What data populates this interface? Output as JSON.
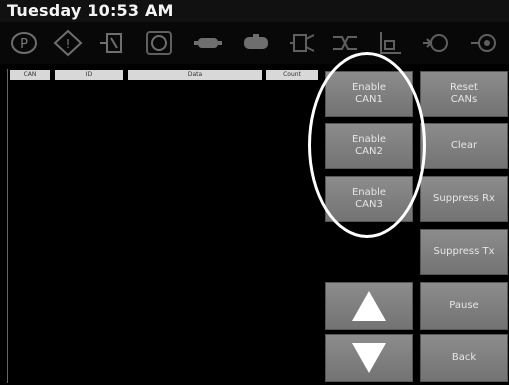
{
  "header": {
    "datetime": "Tuesday 10:53 AM"
  },
  "toolbar": {
    "icons": [
      {
        "name": "parking-icon",
        "label": "P"
      },
      {
        "name": "warning-diamond-icon",
        "label": "!"
      },
      {
        "name": "power-pack-icon"
      },
      {
        "name": "engine-icon"
      },
      {
        "name": "coupling-icon"
      },
      {
        "name": "connector-icon"
      },
      {
        "name": "valve-icon"
      },
      {
        "name": "network-icon"
      },
      {
        "name": "filter-icon"
      },
      {
        "name": "hydraulic-motor-icon"
      },
      {
        "name": "gear-motor-icon"
      }
    ]
  },
  "log": {
    "columns": [
      "CAN",
      "ID",
      "Data",
      "Count"
    ]
  },
  "buttons": {
    "enable_can1": "Enable\nCAN1",
    "enable_can2": "Enable\nCAN2",
    "enable_can3": "Enable\nCAN3",
    "reset_cans": "Reset\nCANs",
    "clear": "Clear",
    "suppress_rx": "Suppress Rx",
    "suppress_tx": "Suppress Tx",
    "pause": "Pause",
    "back": "Back"
  },
  "colors": {
    "button_bg": "#808080",
    "button_text": "#e6e6e6",
    "background": "#000000",
    "annotation": "#ffffff"
  }
}
